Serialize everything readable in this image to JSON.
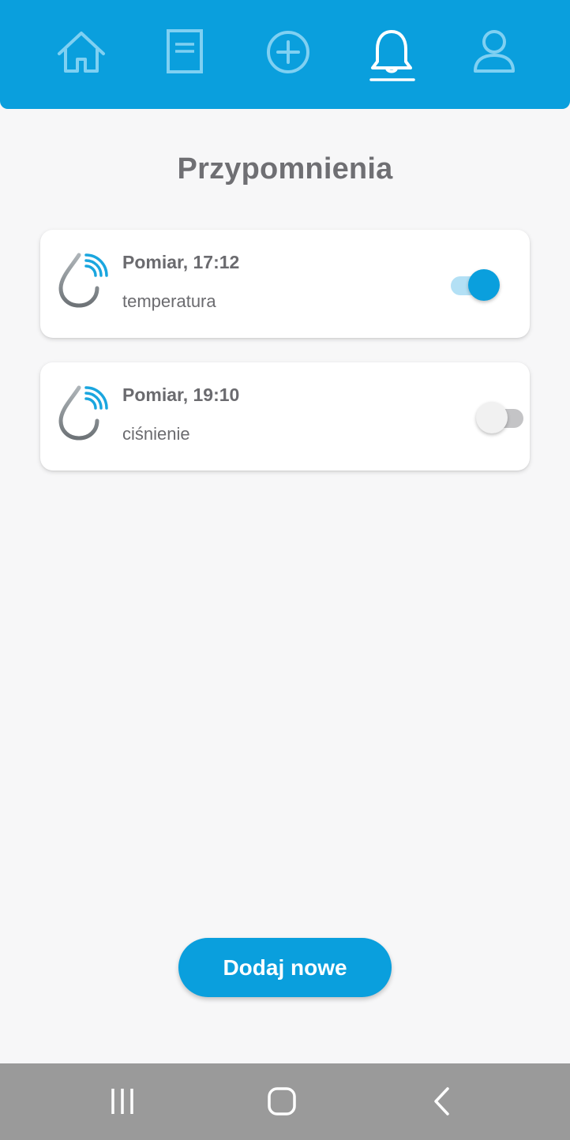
{
  "nav": {
    "items": [
      {
        "icon": "home-icon",
        "label": "Home",
        "active": false
      },
      {
        "icon": "document-icon",
        "label": "Records",
        "active": false
      },
      {
        "icon": "plus-circle-icon",
        "label": "Add",
        "active": false
      },
      {
        "icon": "bell-icon",
        "label": "Reminders",
        "active": true
      },
      {
        "icon": "user-icon",
        "label": "Profile",
        "active": false
      }
    ]
  },
  "page": {
    "title": "Przypomnienia"
  },
  "reminders": [
    {
      "title": "Pomiar, 17:12",
      "subtitle": "temperatura",
      "enabled": true
    },
    {
      "title": "Pomiar, 19:10",
      "subtitle": "ciśnienie",
      "enabled": false
    }
  ],
  "actions": {
    "add_label": "Dodaj nowe"
  },
  "colors": {
    "primary": "#0a9fdd",
    "background": "#f7f7f8",
    "text": "#6b6b6f",
    "system_bar": "#9a9a9a"
  }
}
